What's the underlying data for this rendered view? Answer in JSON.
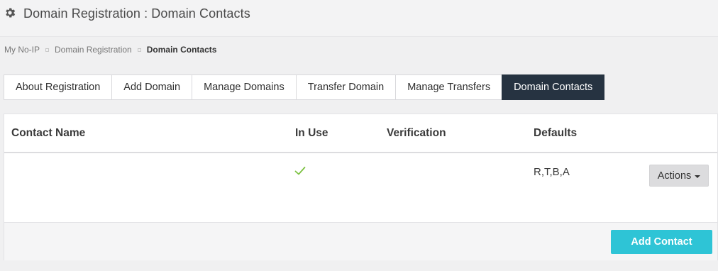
{
  "header": {
    "icon": "gear-icon",
    "title": "Domain Registration : Domain Contacts"
  },
  "breadcrumb": {
    "items": [
      "My No-IP",
      "Domain Registration",
      "Domain Contacts"
    ]
  },
  "tabs": [
    {
      "label": "About Registration",
      "active": false
    },
    {
      "label": "Add Domain",
      "active": false
    },
    {
      "label": "Manage Domains",
      "active": false
    },
    {
      "label": "Transfer Domain",
      "active": false
    },
    {
      "label": "Manage Transfers",
      "active": false
    },
    {
      "label": "Domain Contacts",
      "active": true
    }
  ],
  "table": {
    "columns": [
      "Contact Name",
      "In Use",
      "Verification",
      "Defaults"
    ],
    "rows": [
      {
        "contact_name": "",
        "in_use_icon": "checkmark-icon",
        "verification": "",
        "defaults": "R,T,B,A",
        "actions_label": "Actions"
      }
    ]
  },
  "footer": {
    "add_contact_label": "Add Contact"
  },
  "colors": {
    "active_tab": "#263341",
    "accent": "#2ec4d6",
    "check": "#7cc242"
  }
}
